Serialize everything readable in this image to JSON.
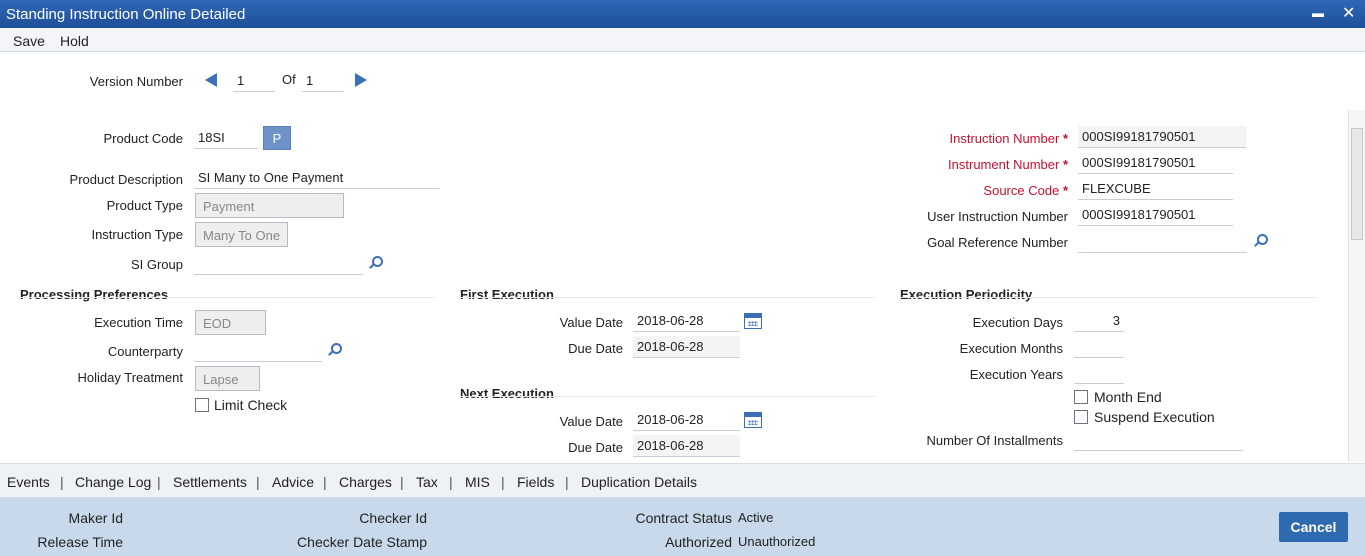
{
  "window": {
    "title": "Standing Instruction Online Detailed",
    "minimize": "▬",
    "close": "✕"
  },
  "menu": {
    "save": "Save",
    "hold": "Hold"
  },
  "version": {
    "label": "Version Number",
    "current": "1",
    "of": "Of",
    "total": "1"
  },
  "product": {
    "code_label": "Product Code",
    "code": "18SI",
    "p_button": "P",
    "desc_label": "Product Description",
    "desc": "SI Many to One Payment",
    "type_label": "Product Type",
    "type": "Payment",
    "instr_type_label": "Instruction Type",
    "instr_type": "Many To One",
    "si_group_label": "SI Group",
    "si_group": ""
  },
  "right": {
    "instruction_number_label": "Instruction Number",
    "instruction_number": "000SI99181790501",
    "instrument_number_label": "Instrument Number",
    "instrument_number": "000SI99181790501",
    "source_code_label": "Source Code",
    "source_code": "FLEXCUBE",
    "user_instruction_label": "User Instruction Number",
    "user_instruction": "000SI99181790501",
    "goal_ref_label": "Goal Reference Number",
    "goal_ref": "",
    "required": "*"
  },
  "processing": {
    "title": "Processing Preferences",
    "exec_time_label": "Execution Time",
    "exec_time": "EOD",
    "counterparty_label": "Counterparty",
    "counterparty": "",
    "holiday_label": "Holiday Treatment",
    "holiday": "Lapse",
    "limit_check": "Limit Check"
  },
  "first_exec": {
    "title": "First Execution",
    "value_date_label": "Value Date",
    "value_date": "2018-06-28",
    "due_date_label": "Due Date",
    "due_date": "2018-06-28"
  },
  "next_exec": {
    "title": "Next Execution",
    "value_date_label": "Value Date",
    "value_date": "2018-06-28",
    "due_date_label": "Due Date",
    "due_date": "2018-06-28"
  },
  "periodicity": {
    "title": "Execution Periodicity",
    "days_label": "Execution Days",
    "days": "3",
    "months_label": "Execution Months",
    "months": "",
    "years_label": "Execution Years",
    "years": "",
    "month_end": "Month End",
    "suspend": "Suspend Execution",
    "installments_label": "Number Of Installments",
    "installments": ""
  },
  "tabs": [
    "Events",
    "Change Log",
    "Settlements",
    "Advice",
    "Charges",
    "Tax",
    "MIS",
    "Fields",
    "Duplication Details"
  ],
  "tab_separator": "|",
  "footer": {
    "maker_id_label": "Maker Id",
    "maker_id": "",
    "release_time_label": "Release Time",
    "release_time": "",
    "checker_id_label": "Checker Id",
    "checker_id": "",
    "checker_stamp_label": "Checker Date Stamp",
    "checker_stamp": "",
    "contract_status_label": "Contract Status",
    "contract_status": "Active",
    "authorized_label": "Authorized",
    "authorized": "Unauthorized",
    "cancel": "Cancel"
  },
  "colors": {
    "titlebar": "#2a5fab",
    "required": "#c8102e",
    "footer": "#c7d9ea",
    "button": "#2d6ab0"
  }
}
